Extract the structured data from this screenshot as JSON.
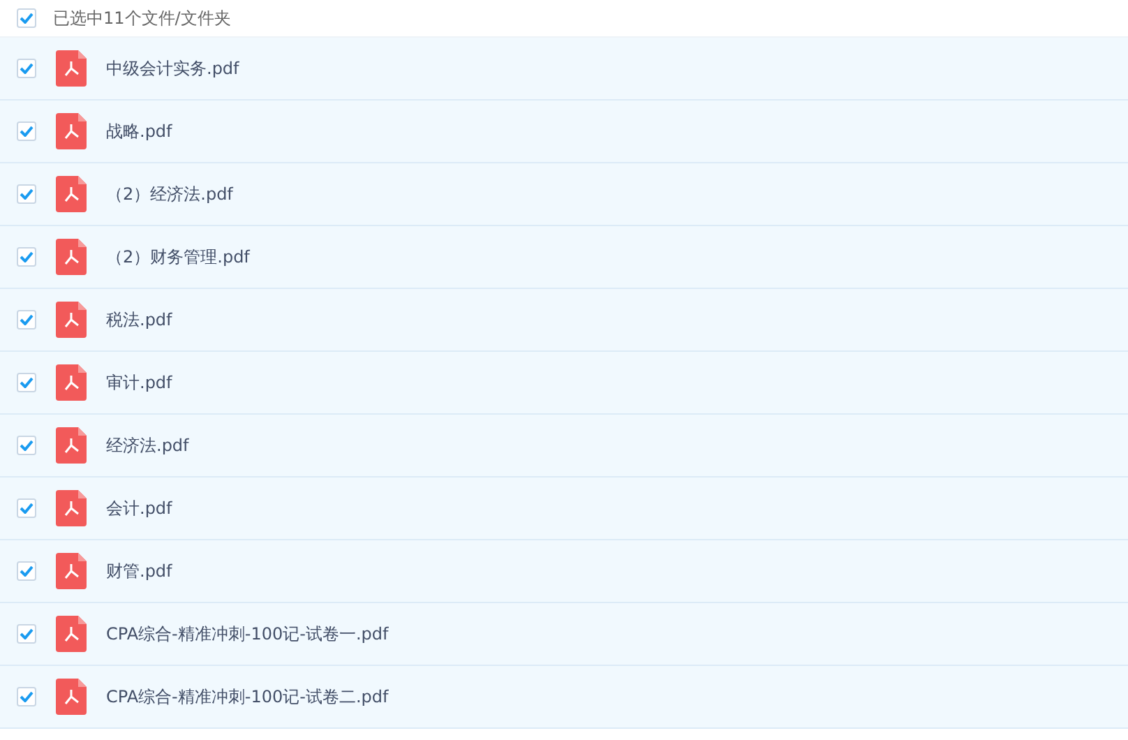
{
  "header": {
    "label": "已选中11个文件/文件夹",
    "checked": true
  },
  "files": [
    {
      "name": "中级会计实务.pdf",
      "checked": true
    },
    {
      "name": "战略.pdf",
      "checked": true
    },
    {
      "name": "（2）经济法.pdf",
      "checked": true
    },
    {
      "name": "（2）财务管理.pdf",
      "checked": true
    },
    {
      "name": "税法.pdf",
      "checked": true
    },
    {
      "name": "审计.pdf",
      "checked": true
    },
    {
      "name": "经济法.pdf",
      "checked": true
    },
    {
      "name": "会计.pdf",
      "checked": true
    },
    {
      "name": "财管.pdf",
      "checked": true
    },
    {
      "name": "CPA综合-精准冲刺-100记-试卷一.pdf",
      "checked": true
    },
    {
      "name": "CPA综合-精准冲刺-100记-试卷二.pdf",
      "checked": true
    }
  ]
}
